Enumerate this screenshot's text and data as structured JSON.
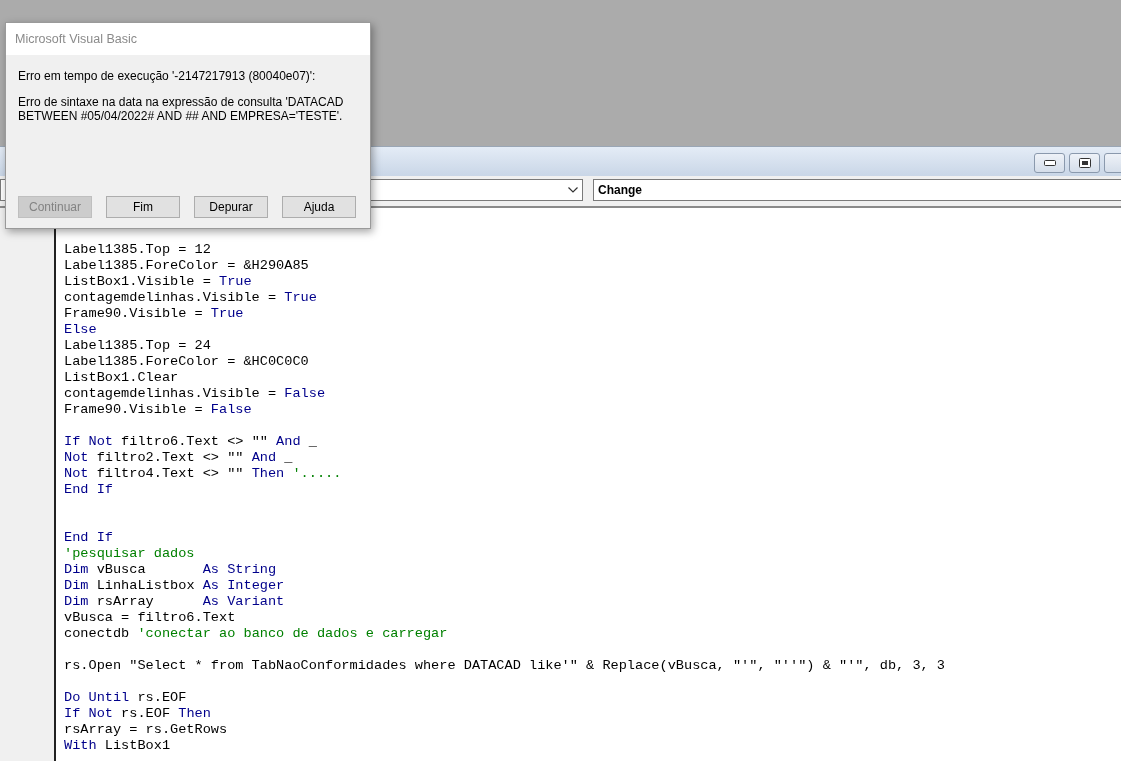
{
  "editor": {
    "window_buttons": [
      {
        "kind": "minimize"
      },
      {
        "kind": "restore"
      }
    ],
    "procedure_combo": {
      "value": "Change"
    },
    "code_lines": [
      {
        "kind": "code",
        "segments": [
          {
            "kind": "code",
            "text": "Label1385.Top = 12"
          }
        ]
      },
      {
        "kind": "code",
        "segments": [
          {
            "kind": "code",
            "text": "Label1385.ForeColor = &H290A85"
          }
        ]
      },
      {
        "kind": "code",
        "segments": [
          {
            "kind": "code",
            "text": "ListBox1.Visible = "
          },
          {
            "kind": "keyword",
            "text": "True"
          }
        ]
      },
      {
        "kind": "code",
        "segments": [
          {
            "kind": "code",
            "text": "contagemdelinhas.Visible = "
          },
          {
            "kind": "keyword",
            "text": "True"
          }
        ]
      },
      {
        "kind": "code",
        "segments": [
          {
            "kind": "code",
            "text": "Frame90.Visible = "
          },
          {
            "kind": "keyword",
            "text": "True"
          }
        ]
      },
      {
        "kind": "code",
        "segments": [
          {
            "kind": "keyword",
            "text": "Else"
          }
        ]
      },
      {
        "kind": "code",
        "segments": [
          {
            "kind": "code",
            "text": "Label1385.Top = 24"
          }
        ]
      },
      {
        "kind": "code",
        "segments": [
          {
            "kind": "code",
            "text": "Label1385.ForeColor = &HC0C0C0"
          }
        ]
      },
      {
        "kind": "code",
        "segments": [
          {
            "kind": "code",
            "text": "ListBox1.Clear"
          }
        ]
      },
      {
        "kind": "code",
        "segments": [
          {
            "kind": "code",
            "text": "contagemdelinhas.Visible = "
          },
          {
            "kind": "keyword",
            "text": "False"
          }
        ]
      },
      {
        "kind": "code",
        "segments": [
          {
            "kind": "code",
            "text": "Frame90.Visible = "
          },
          {
            "kind": "keyword",
            "text": "False"
          }
        ]
      },
      {
        "kind": "blank"
      },
      {
        "kind": "code",
        "segments": [
          {
            "kind": "keyword",
            "text": "If Not"
          },
          {
            "kind": "code",
            "text": " filtro6.Text <> \"\" "
          },
          {
            "kind": "keyword",
            "text": "And"
          },
          {
            "kind": "code",
            "text": " _"
          }
        ]
      },
      {
        "kind": "code",
        "segments": [
          {
            "kind": "keyword",
            "text": "Not"
          },
          {
            "kind": "code",
            "text": " filtro2.Text <> \"\" "
          },
          {
            "kind": "keyword",
            "text": "And"
          },
          {
            "kind": "code",
            "text": " _"
          }
        ]
      },
      {
        "kind": "code",
        "segments": [
          {
            "kind": "keyword",
            "text": "Not"
          },
          {
            "kind": "code",
            "text": " filtro4.Text <> \"\" "
          },
          {
            "kind": "keyword",
            "text": "Then"
          },
          {
            "kind": "comment",
            "text": " '....."
          }
        ]
      },
      {
        "kind": "code",
        "segments": [
          {
            "kind": "keyword",
            "text": "End If"
          }
        ]
      },
      {
        "kind": "blank"
      },
      {
        "kind": "blank"
      },
      {
        "kind": "code",
        "segments": [
          {
            "kind": "keyword",
            "text": "End If"
          }
        ]
      },
      {
        "kind": "code",
        "segments": [
          {
            "kind": "comment",
            "text": "'pesquisar dados"
          }
        ]
      },
      {
        "kind": "code",
        "segments": [
          {
            "kind": "keyword",
            "text": "Dim"
          },
          {
            "kind": "code",
            "text": " vBusca       "
          },
          {
            "kind": "keyword",
            "text": "As String"
          }
        ]
      },
      {
        "kind": "code",
        "segments": [
          {
            "kind": "keyword",
            "text": "Dim"
          },
          {
            "kind": "code",
            "text": " LinhaListbox "
          },
          {
            "kind": "keyword",
            "text": "As Integer"
          }
        ]
      },
      {
        "kind": "code",
        "segments": [
          {
            "kind": "keyword",
            "text": "Dim"
          },
          {
            "kind": "code",
            "text": " rsArray      "
          },
          {
            "kind": "keyword",
            "text": "As Variant"
          }
        ]
      },
      {
        "kind": "code",
        "segments": [
          {
            "kind": "code",
            "text": "vBusca = filtro6.Text"
          }
        ]
      },
      {
        "kind": "code",
        "segments": [
          {
            "kind": "code",
            "text": "conectdb "
          },
          {
            "kind": "comment",
            "text": "'conectar ao banco de dados e carregar"
          }
        ]
      },
      {
        "kind": "blank"
      },
      {
        "kind": "code",
        "segments": [
          {
            "kind": "code",
            "text": "rs.Open \"Select * from TabNaoConformidades where DATACAD like'\" & Replace(vBusca, \"'\", \"''\") & \"'\", db, 3, 3"
          }
        ]
      },
      {
        "kind": "blank"
      },
      {
        "kind": "code",
        "segments": [
          {
            "kind": "keyword",
            "text": "Do Until"
          },
          {
            "kind": "code",
            "text": " rs.EOF"
          }
        ]
      },
      {
        "kind": "code",
        "segments": [
          {
            "kind": "keyword",
            "text": "If Not"
          },
          {
            "kind": "code",
            "text": " rs.EOF "
          },
          {
            "kind": "keyword",
            "text": "Then"
          }
        ]
      },
      {
        "kind": "code",
        "segments": [
          {
            "kind": "code",
            "text": "rsArray = rs.GetRows"
          }
        ]
      },
      {
        "kind": "code",
        "segments": [
          {
            "kind": "keyword",
            "text": "With"
          },
          {
            "kind": "code",
            "text": " ListBox1"
          }
        ]
      }
    ]
  },
  "dialog": {
    "title": "Microsoft Visual Basic",
    "error_line": "Erro em tempo de execução '-2147217913 (80040e07)':",
    "message": "Erro de sintaxe na data na expressão de consulta 'DATACAD BETWEEN #05/04/2022# AND ## AND EMPRESA='TESTE'.",
    "buttons": [
      {
        "label": "Continuar",
        "disabled": true
      },
      {
        "label": "Fim",
        "disabled": false
      },
      {
        "label": "Depurar",
        "disabled": false
      },
      {
        "label": "Ajuda",
        "disabled": false
      }
    ]
  }
}
